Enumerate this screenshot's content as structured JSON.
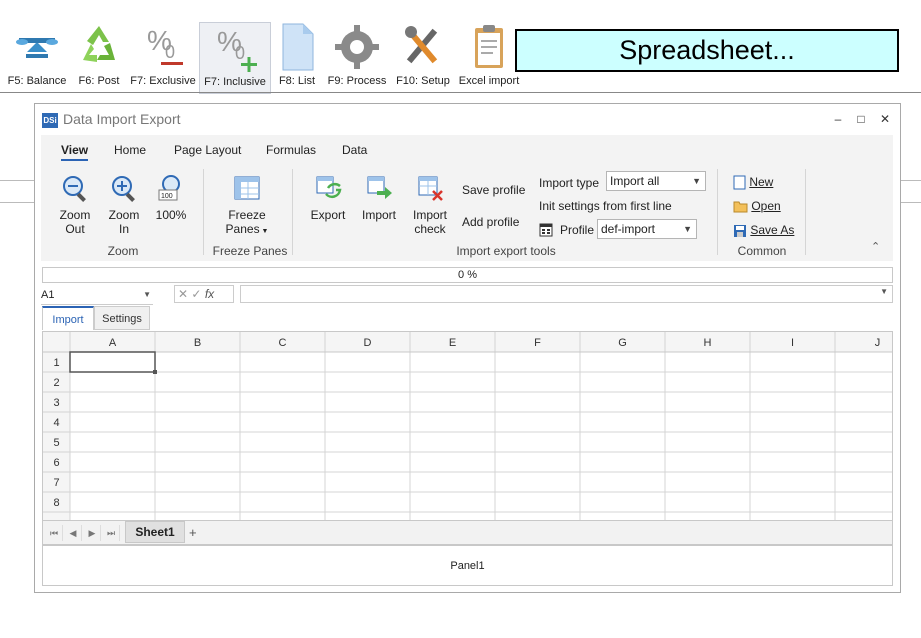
{
  "toolbar": {
    "buttons": [
      {
        "label": "F5: Balance",
        "icon": "balance-scale-icon"
      },
      {
        "label": "F6: Post",
        "icon": "recycle-icon"
      },
      {
        "label": "F7: Exclusive",
        "icon": "percent-minus-icon"
      },
      {
        "label": "F7: Inclusive",
        "icon": "percent-plus-icon"
      },
      {
        "label": "F8: List",
        "icon": "document-icon"
      },
      {
        "label": "F9: Process",
        "icon": "gear-icon"
      },
      {
        "label": "F10: Setup",
        "icon": "tools-icon"
      },
      {
        "label": "Excel import",
        "icon": "clipboard-icon"
      }
    ],
    "title": "Spreadsheet..."
  },
  "window": {
    "title": "Data Import Export",
    "logo": "DSi",
    "min": "–",
    "max": "□",
    "close": "✕"
  },
  "ribbon": {
    "tabs": [
      "View",
      "Home",
      "Page Layout",
      "Formulas",
      "Data"
    ],
    "zoom": {
      "zoom_out_1": "Zoom",
      "zoom_out_2": "Out",
      "zoom_in_1": "Zoom",
      "zoom_in_2": "In",
      "zoom_100": "100%",
      "group": "Zoom"
    },
    "freeze": {
      "line1": "Freeze",
      "line2": "Panes",
      "group": "Freeze Panes"
    },
    "tools": {
      "export": "Export",
      "import": "Import",
      "check_1": "Import",
      "check_2": "check",
      "save_profile": "Save profile",
      "add_profile": "Add profile",
      "import_type_label": "Import type",
      "import_type_value": "Import all",
      "init_settings": "Init settings from first line",
      "profile_label": "Profile",
      "profile_value": "def-import",
      "group": "Import export tools"
    },
    "common": {
      "new": "New",
      "open": "Open",
      "save_as": "Save As",
      "group": "Common"
    }
  },
  "progress": "0 %",
  "formula_bar": {
    "cell": "A1",
    "cancel": "✕",
    "confirm": "✓",
    "fx": "fx"
  },
  "tabs": [
    "Import",
    "Settings"
  ],
  "grid": {
    "columns": [
      "A",
      "B",
      "C",
      "D",
      "E",
      "F",
      "G",
      "H",
      "I",
      "J"
    ],
    "rows": [
      "1",
      "2",
      "3",
      "4",
      "5",
      "6",
      "7",
      "8"
    ]
  },
  "sheet_tab": "Sheet1",
  "panel": "Panel1"
}
